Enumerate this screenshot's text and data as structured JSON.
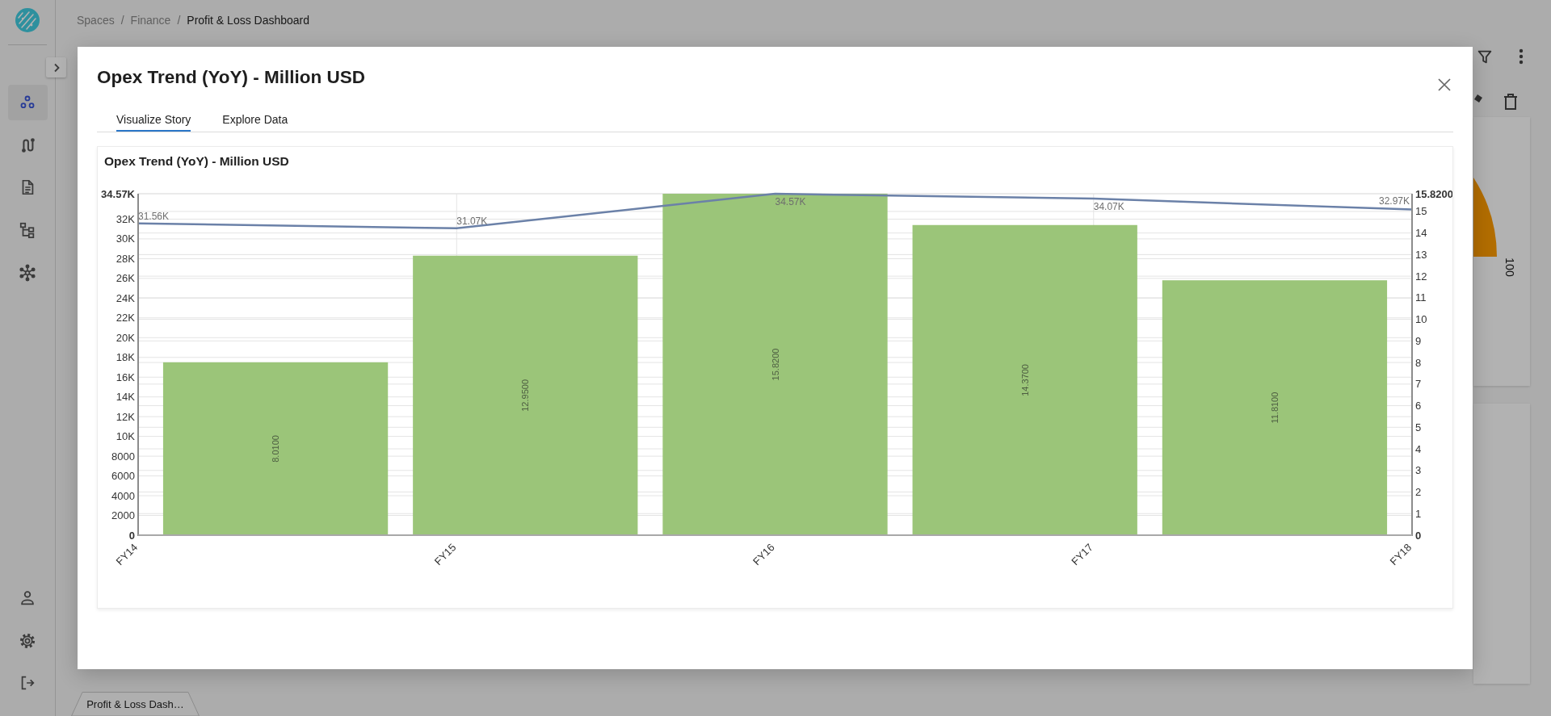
{
  "sidebar": {
    "nav_items": [
      {
        "selected": true
      },
      {
        "selected": false
      },
      {
        "selected": false
      },
      {
        "selected": false
      },
      {
        "selected": false
      }
    ]
  },
  "breadcrumb": [
    {
      "label": "Spaces",
      "current": false
    },
    {
      "separator": "/",
      "label": "Finance",
      "current": false
    },
    {
      "separator": "/",
      "label": "Profit & Loss Dashboard",
      "current": true
    }
  ],
  "gauge_card": {
    "label": "100"
  },
  "page_tabs": [
    {
      "label": "Profit & Loss Dash…"
    }
  ],
  "modal": {
    "title": "Opex Trend (YoY) - Million USD",
    "tabs": [
      {
        "label": "Visualize Story",
        "selected": true
      },
      {
        "label": "Explore Data",
        "selected": false
      }
    ],
    "chart_card": {
      "chart_data": {
        "type": "bar",
        "title": "Opex Trend (YoY) - Million USD",
        "categories": [
          "FY14",
          "FY15",
          "FY16",
          "FY17",
          "FY18"
        ],
        "series": [
          {
            "axis": "y2",
            "color": "#9bc579",
            "values": [
              8.01,
              12.95,
              15.82,
              14.37,
              11.81
            ],
            "value_labels": [
              "8.0100",
              "12.9500",
              "15.8200",
              "14.3700",
              "11.8100"
            ]
          },
          {
            "type": "line",
            "color": "#6b81a8",
            "values": [
              31560,
              31070,
              34570,
              34070,
              32970
            ],
            "value_labels": [
              "31.56K",
              "31.07K",
              "34.57K",
              "34.07K",
              "32.97K"
            ]
          }
        ],
        "grid": true,
        "ylim": [
          0,
          34570
        ],
        "yticks": [
          0,
          2000,
          4000,
          6000,
          8000,
          {
            "value": 10000,
            "label": "10K"
          },
          {
            "value": 12000,
            "label": "12K"
          },
          {
            "value": 14000,
            "label": "14K"
          },
          {
            "value": 16000,
            "label": "16K"
          },
          {
            "value": 18000,
            "label": "18K"
          },
          {
            "value": 20000,
            "label": "20K"
          },
          {
            "value": 22000,
            "label": "22K"
          },
          {
            "value": 24000,
            "label": "24K"
          },
          {
            "value": 26000,
            "label": "26K"
          },
          {
            "value": 28000,
            "label": "28K"
          },
          {
            "value": 30000,
            "label": "30K"
          },
          {
            "value": 32000,
            "label": "32K"
          },
          {
            "value": 34570,
            "label": "34.57K"
          }
        ],
        "y2lim": [
          0,
          15.82
        ],
        "y2ticks": [
          0,
          1,
          2,
          3,
          4,
          5,
          6,
          7,
          8,
          9,
          10,
          11,
          12,
          13,
          14,
          15,
          {
            "value": 15.82,
            "label": "15.8200"
          }
        ]
      }
    }
  }
}
